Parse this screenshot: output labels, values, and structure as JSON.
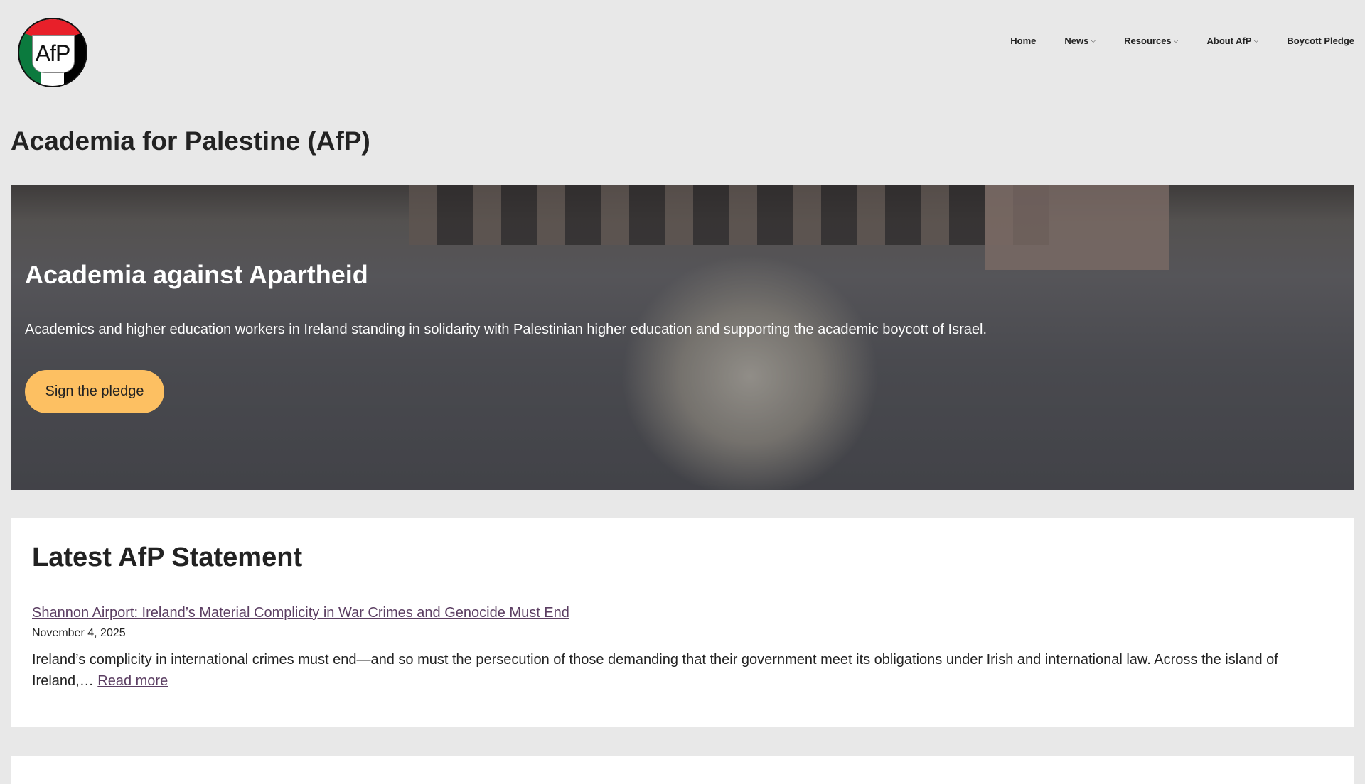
{
  "logo": {
    "text": "AfP"
  },
  "nav": {
    "items": [
      {
        "label": "Home",
        "dropdown": false
      },
      {
        "label": "News",
        "dropdown": true
      },
      {
        "label": "Resources",
        "dropdown": true
      },
      {
        "label": "About AfP",
        "dropdown": true
      },
      {
        "label": "Boycott Pledge",
        "dropdown": false
      }
    ],
    "chevron": "⌵"
  },
  "page_title": "Academia for Palestine (AfP)",
  "hero": {
    "title": "Academia against Apartheid",
    "text": "Academics and higher education workers in Ireland standing in solidarity with Palestinian higher education and supporting the academic boycott of Israel.",
    "button": "Sign the pledge",
    "button_color": "#fdc062"
  },
  "statement": {
    "heading": "Latest AfP Statement",
    "link": "Shannon Airport: Ireland’s Material Complicity in War Crimes and Genocide Must End",
    "date": "November 4, 2025",
    "excerpt": "Ireland’s complicity in international crimes must end—and so must the persecution of those demanding that their government meet its obligations under Irish and international law. Across the island of Ireland,…",
    "read_more": "Read more"
  }
}
